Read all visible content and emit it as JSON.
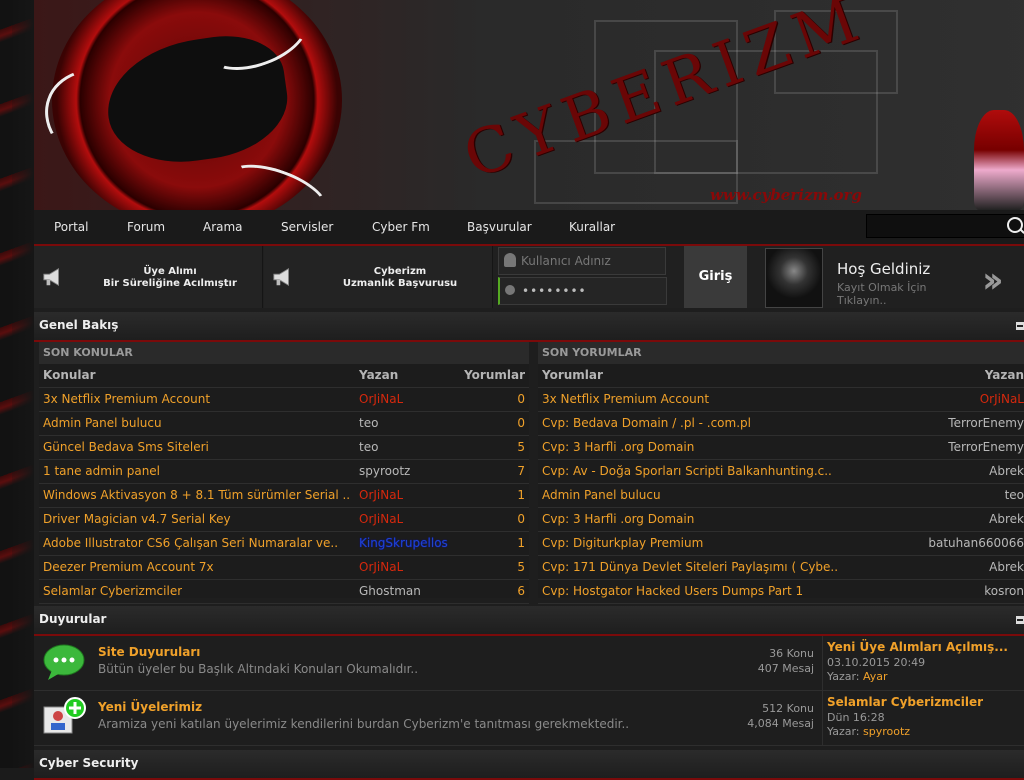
{
  "header": {
    "brand": "CYBERIZM",
    "url": "www.cyberizm.org"
  },
  "nav": {
    "items": [
      "Portal",
      "Forum",
      "Arama",
      "Servisler",
      "Cyber Fm",
      "Başvurular",
      "Kurallar"
    ]
  },
  "announcements": [
    {
      "line1": "Üye Alımı",
      "line2": "Bir Süreliğine Acılmıştır"
    },
    {
      "line1": "Cyberizm",
      "line2": "Uzmanlık Başvurusu"
    }
  ],
  "login": {
    "username_placeholder": "Kullanıcı Adınız",
    "password_value": "••••••••",
    "button": "Giriş"
  },
  "welcome": {
    "title": "Hoş Geldiniz",
    "subtitle": "Kayıt Olmak İçin Tıklayın.."
  },
  "overview": {
    "title": "Genel Bakış",
    "recent_topics": {
      "header": "SON KONULAR",
      "columns": [
        "Konular",
        "Yazan",
        "Yorumlar"
      ],
      "rows": [
        {
          "title": "3x Netflix Premium Account",
          "author": "OrJiNaL",
          "author_style": "red",
          "count": "0"
        },
        {
          "title": "Admin Panel bulucu",
          "author": "teo",
          "author_style": "gray",
          "count": "0"
        },
        {
          "title": "Güncel Bedava Sms Siteleri",
          "author": "teo",
          "author_style": "gray",
          "count": "5"
        },
        {
          "title": "1 tane admin panel",
          "author": "spyrootz",
          "author_style": "gray",
          "count": "7"
        },
        {
          "title": "Windows Aktivasyon 8 + 8.1 Tüm sürümler Serial ..",
          "author": "OrJiNaL",
          "author_style": "red",
          "count": "1"
        },
        {
          "title": "Driver Magician v4.7 Serial Key",
          "author": "OrJiNaL",
          "author_style": "red",
          "count": "0"
        },
        {
          "title": "Adobe Illustrator CS6 Çalışan Seri Numaralar ve..",
          "author": "KingSkrupellos",
          "author_style": "blue",
          "count": "1"
        },
        {
          "title": "Deezer Premium Account 7x",
          "author": "OrJiNaL",
          "author_style": "red",
          "count": "5"
        },
        {
          "title": "Selamlar Cyberizmciler",
          "author": "Ghostman",
          "author_style": "gray",
          "count": "6"
        }
      ]
    },
    "recent_comments": {
      "header": "SON YORUMLAR",
      "columns": [
        "Yorumlar",
        "Yazan"
      ],
      "rows": [
        {
          "title": "3x Netflix Premium Account",
          "author": "OrJiNaL",
          "author_style": "red"
        },
        {
          "title": "Cvp: Bedava Domain / .pl - .com.pl",
          "author": "TerrorEnemy",
          "author_style": "gray"
        },
        {
          "title": "Cvp: 3 Harfli .org Domain",
          "author": "TerrorEnemy",
          "author_style": "gray"
        },
        {
          "title": "Cvp: Av - Doğa Sporları Scripti Balkanhunting.c..",
          "author": "Abrek",
          "author_style": "gray"
        },
        {
          "title": "Admin Panel bulucu",
          "author": "teo",
          "author_style": "gray"
        },
        {
          "title": "Cvp: 3 Harfli .org Domain",
          "author": "Abrek",
          "author_style": "gray"
        },
        {
          "title": "Cvp: Digiturkplay Premium",
          "author": "batuhan660066",
          "author_style": "gray"
        },
        {
          "title": "Cvp: 171 Dünya Devlet Siteleri Paylaşımı ( Cybe..",
          "author": "Abrek",
          "author_style": "gray"
        },
        {
          "title": "Cvp: Hostgator Hacked Users Dumps Part 1",
          "author": "kosron",
          "author_style": "gray"
        }
      ]
    }
  },
  "duyurular": {
    "title": "Duyurular",
    "forums": [
      {
        "name": "Site Duyuruları",
        "desc": "Bütün üyeler bu Başlık Altındaki Konuları Okumalıdır..",
        "topics": "36 Konu",
        "posts": "407 Mesaj",
        "last_title": "Yeni Üye Alımları Açılmış...",
        "last_date": "03.10.2015 20:49",
        "last_author_label": "Yazar:",
        "last_author": "Ayar"
      },
      {
        "name": "Yeni Üyelerimiz",
        "desc": "Aramiza yeni katılan üyelerimiz kendilerini burdan Cyberizm'e tanıtması gerekmektedir..",
        "topics": "512 Konu",
        "posts": "4,084 Mesaj",
        "last_title": "Selamlar Cyberizmciler",
        "last_date": "Dün 16:28",
        "last_author_label": "Yazar:",
        "last_author": "spyrootz"
      }
    ]
  },
  "cyber_security": {
    "title": "Cyber Security"
  }
}
